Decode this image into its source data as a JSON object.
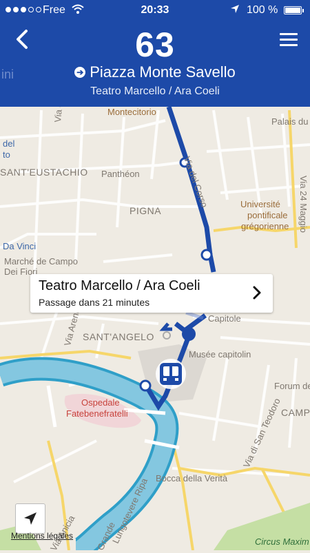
{
  "status_bar": {
    "carrier": "Free",
    "time": "20:33",
    "battery": "100 %"
  },
  "header": {
    "route_number": "63",
    "destination": "Piazza Monte Savello",
    "next_stop": "Teatro Marcello / Ara Coeli",
    "partial_left": "ini"
  },
  "callout": {
    "stop_name": "Teatro Marcello / Ara Coeli",
    "arrival": "Passage dans 21 minutes"
  },
  "map": {
    "labels": {
      "montecitorio": "Montecitorio",
      "palais_du": "Palais du",
      "via_della": "Via della",
      "del": "del",
      "to": "to",
      "santeustachio": "SANT'EUSTACHIO",
      "pantheon": "Panthéon",
      "via_del_corso": "Via del Corso",
      "via_24_maggio": "Via 24 Maggio",
      "universite": "Université",
      "pontificale": "pontificale",
      "gregorienne": "grégorienne",
      "pigna": "PIGNA",
      "da_vinci": "Da Vinci",
      "marche_1": "Marché de Campo",
      "marche_2": "Dei Fiori",
      "capitole": "Capitole",
      "sant_angelo": "SANT'ANGELO",
      "musee": "Musée capitolin",
      "via_arenula": "Via Arenula",
      "ospedale": "Ospedale",
      "fatebenefratelli": "Fatebenefratelli",
      "forum": "Forum des",
      "campi": "CAMPI",
      "via_san_teodoro": "Via di San Teodoro",
      "bocca": "Bocca della Verità",
      "lungotevere": "Lungotevere Ripa",
      "grande": "Grande",
      "anicia": "Via Anicia",
      "circus": "Circus Maxim"
    }
  },
  "footer": {
    "mentions": "Mentions légales"
  },
  "colors": {
    "header_bg": "#1d4aa8",
    "route_line": "#1d4aa8",
    "river": "#2f9fc8",
    "map_bg": "#efebe3",
    "main_road": "#f6d66a"
  }
}
